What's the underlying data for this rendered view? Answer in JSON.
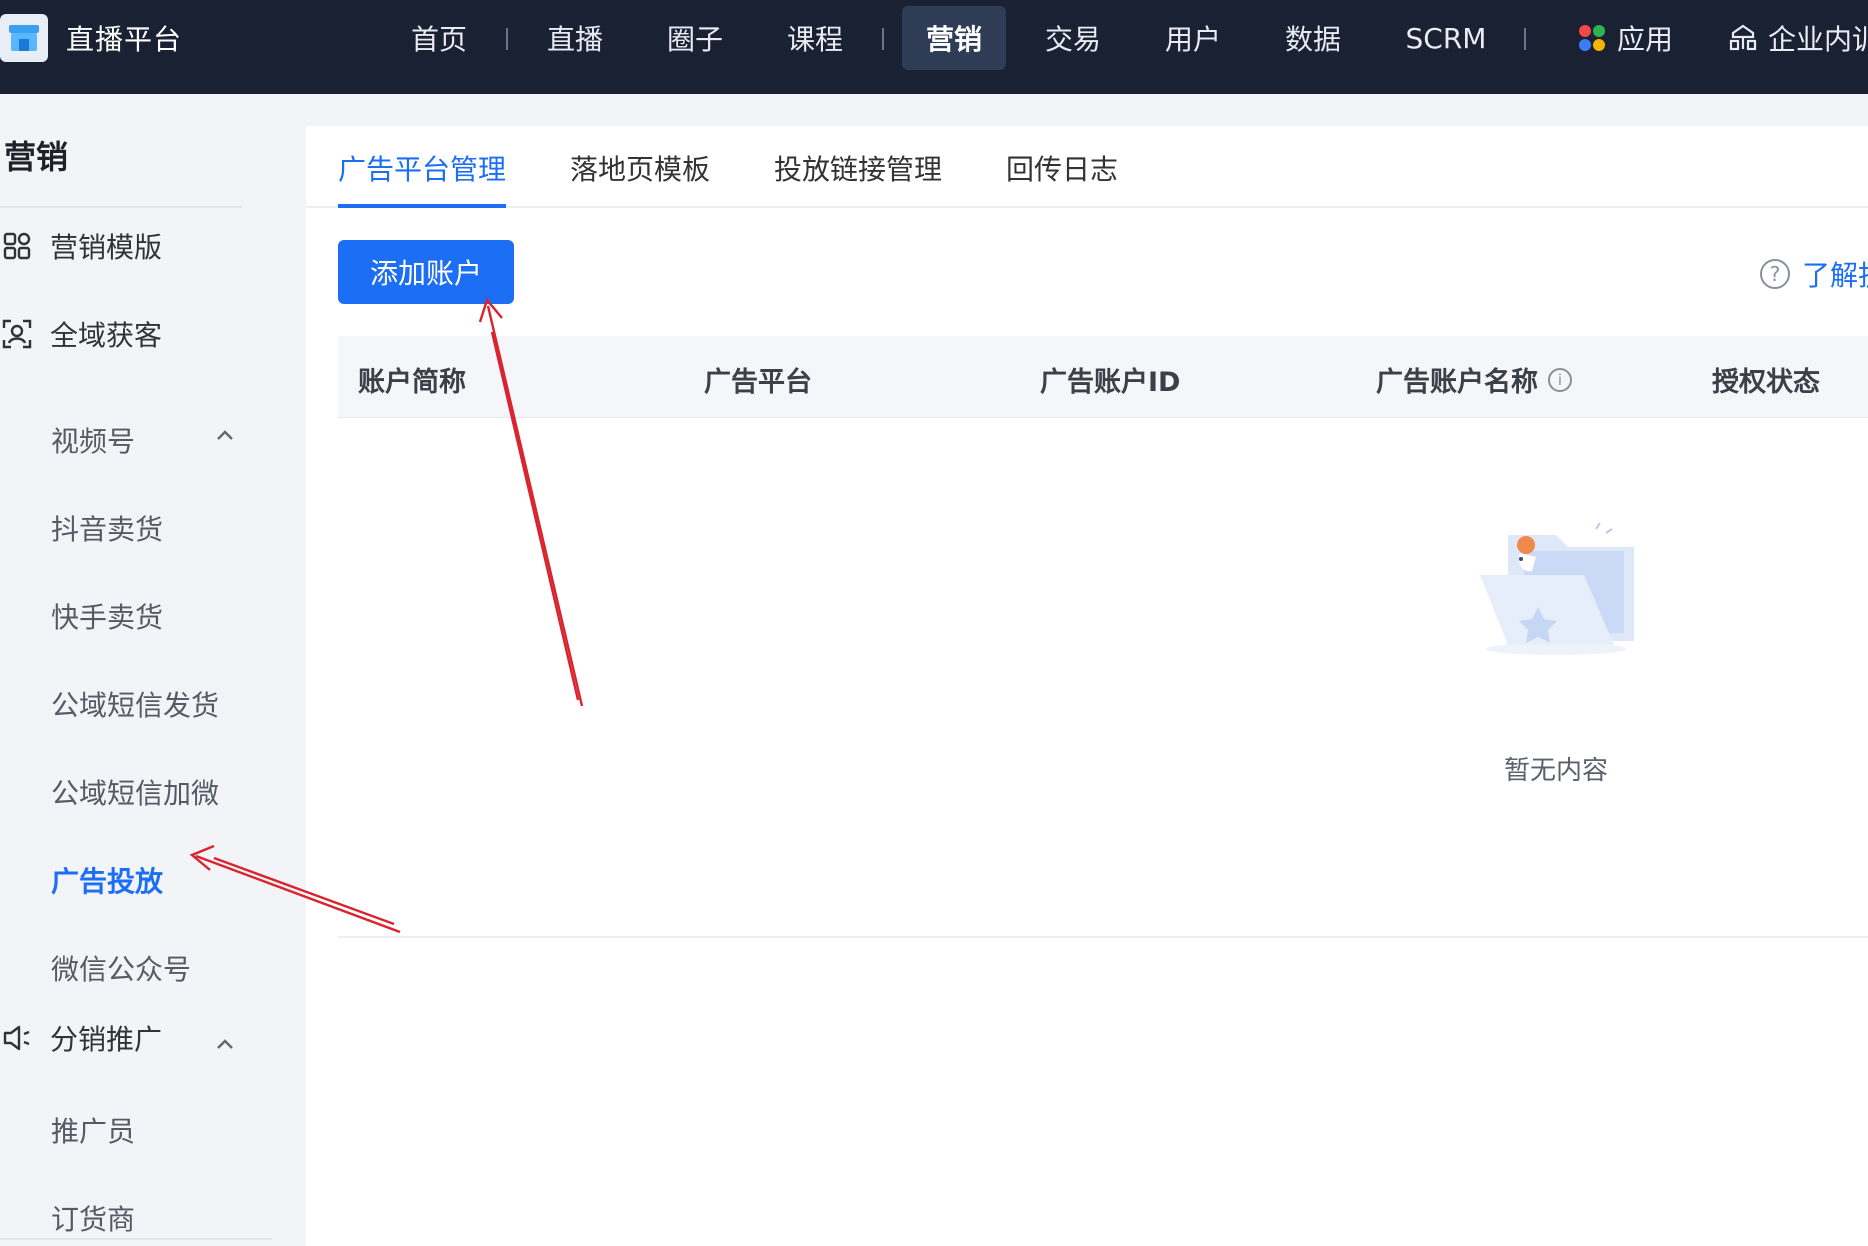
{
  "brand": {
    "name": "直播平台"
  },
  "topnav": {
    "items": [
      {
        "label": "首页"
      },
      {
        "label": "直播"
      },
      {
        "label": "圈子"
      },
      {
        "label": "课程"
      },
      {
        "label": "营销"
      },
      {
        "label": "交易"
      },
      {
        "label": "用户"
      },
      {
        "label": "数据"
      },
      {
        "label": "SCRM"
      },
      {
        "label": "应用"
      },
      {
        "label": "企业内训"
      }
    ],
    "active_index": 4
  },
  "sidebar": {
    "title": "营销",
    "groups": [
      {
        "label": "营销模版",
        "icon": "grid-icon"
      },
      {
        "label": "全域获客",
        "icon": "user-scan-icon",
        "expanded": true,
        "items": [
          "视频号",
          "抖音卖货",
          "快手卖货",
          "公域短信发货",
          "公域短信加微",
          "广告投放",
          "微信公众号"
        ]
      },
      {
        "label": "分销推广",
        "icon": "megaphone-icon",
        "expanded": true,
        "items": [
          "推广员",
          "订货商"
        ]
      }
    ],
    "active_item": "广告投放"
  },
  "tabs": {
    "items": [
      "广告平台管理",
      "落地页模板",
      "投放链接管理",
      "回传日志"
    ],
    "active_index": 0
  },
  "toolbar": {
    "add_account_label": "添加账户",
    "learn_label": "了解投"
  },
  "table": {
    "columns": [
      "账户简称",
      "广告平台",
      "广告账户ID",
      "广告账户名称",
      "授权状态"
    ],
    "rows": [],
    "empty_text": "暂无内容"
  },
  "colors": {
    "topbar_bg": "#1a2133",
    "accent": "#1c6ff5",
    "annotation_arrow": "#d9232d"
  }
}
